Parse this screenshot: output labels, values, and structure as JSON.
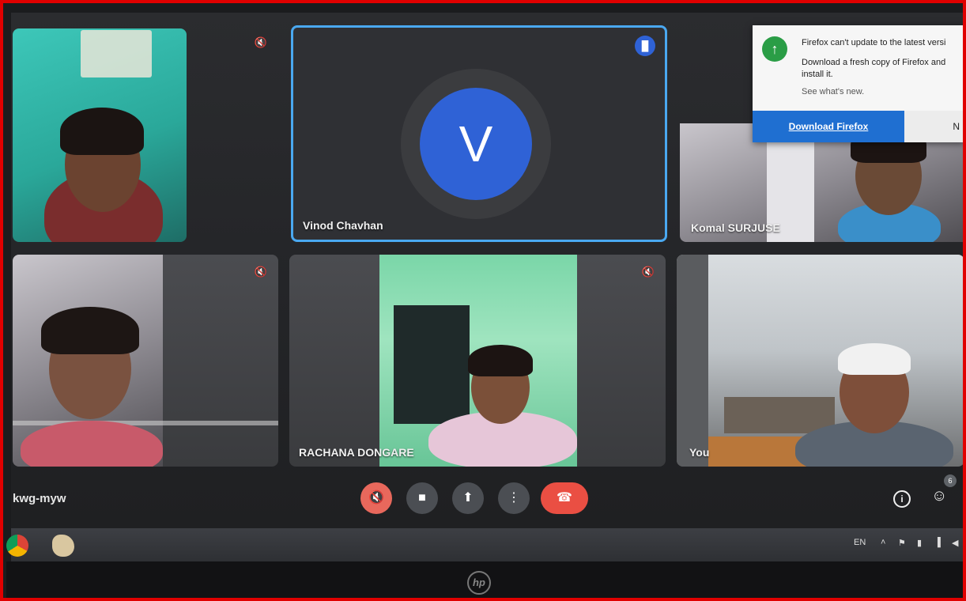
{
  "meeting": {
    "code_suffix": "kwg-myw",
    "participants": [
      {
        "name": "",
        "muted": true
      },
      {
        "name": "Vinod Chavhan",
        "muted": false,
        "avatar_letter": "V",
        "speaking": true
      },
      {
        "name": "Komal SURJUSE",
        "muted": false
      },
      {
        "name": "",
        "muted": true
      },
      {
        "name": "RACHANA DONGARE",
        "muted": true
      },
      {
        "name": "You",
        "muted": false
      }
    ],
    "people_count": "6"
  },
  "notification": {
    "title": "Firefox can't update to the latest versi",
    "body": "Download a fresh copy of Firefox and install it.",
    "link": "See what's new.",
    "primary_button": "Download Firefox",
    "secondary_button": "N"
  },
  "taskbar": {
    "language": "EN"
  },
  "device": {
    "brand_mark": "hp"
  },
  "colors": {
    "frame_border": "#e00000",
    "speaker_highlight": "#4aa8f0",
    "avatar": "#2f62d6",
    "leave_call": "#ea4f43",
    "firefox_button": "#1f6fd1"
  }
}
